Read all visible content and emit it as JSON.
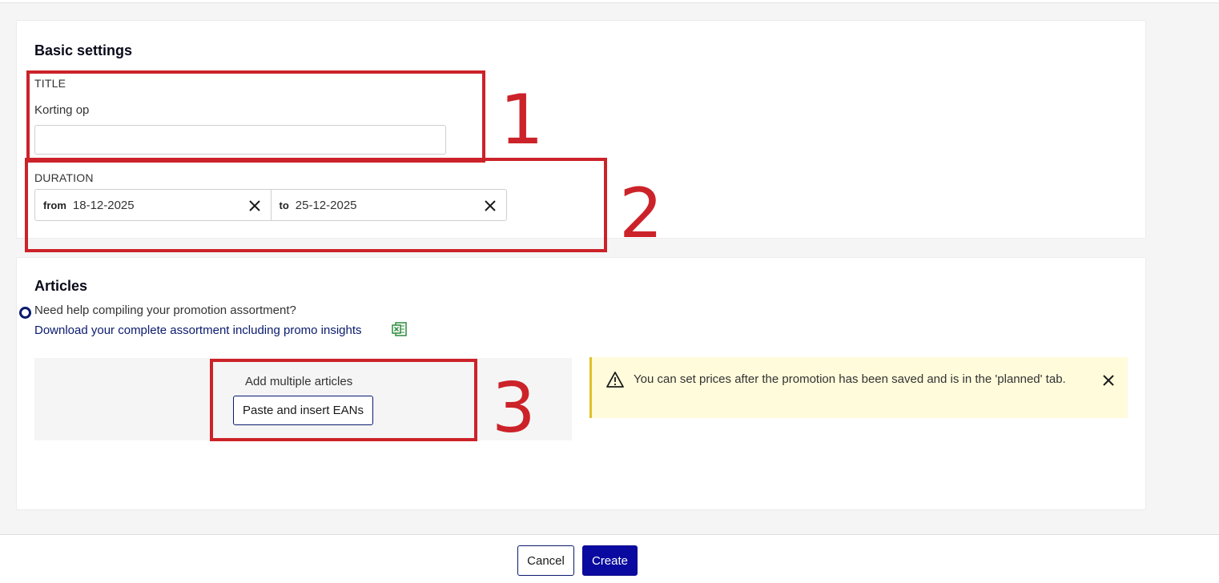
{
  "basic_settings": {
    "heading": "Basic settings",
    "title_label": "TITLE",
    "title_prefix": "Korting op",
    "title_value": "",
    "duration_label": "DURATION",
    "from_prefix": "from",
    "from_value": "18-12-2025",
    "to_prefix": "to",
    "to_value": "25-12-2025"
  },
  "articles": {
    "heading": "Articles",
    "help_text": "Need help compiling your promotion assortment?",
    "download_link": "Download your complete assortment including promo insights",
    "add_multiple_label": "Add multiple articles",
    "paste_button": "Paste and insert EANs",
    "notice_text": "You can set prices after the promotion has been saved and is in the 'planned' tab."
  },
  "annotations": [
    "1",
    "2",
    "3"
  ],
  "footer": {
    "cancel_label": "Cancel",
    "create_label": "Create"
  },
  "colors": {
    "annotation_red": "#cc2229",
    "primary_navy": "#0a0aa0",
    "notice_bg": "#fffbdb",
    "notice_border": "#e0c12a"
  },
  "icons": [
    "close-icon",
    "warning-icon",
    "excel-icon",
    "help-circle-icon"
  ]
}
